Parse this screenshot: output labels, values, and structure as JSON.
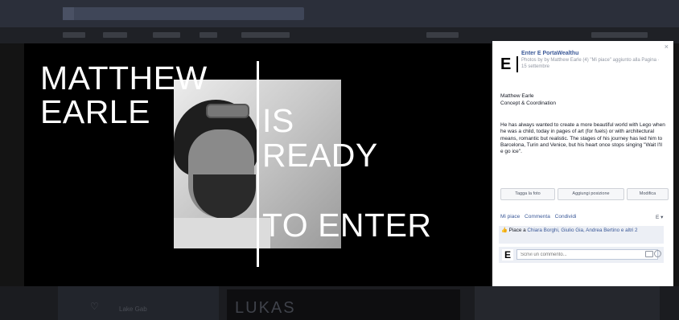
{
  "stage": {
    "headline_name_1": "MATTHEW",
    "headline_name_2": "EARLE",
    "headline_is": "IS",
    "headline_ready": "READY",
    "headline_enter": "TO ENTER"
  },
  "panel": {
    "close_label": "×",
    "logo_letter": "E",
    "page_name": "Enter E PortaWealthu",
    "photo_meta": "Photos by by Matthew Earle (4) \"Mi piace\" aggiunto alla Pagina · 15 settembre",
    "author": "Matthew Earle",
    "role": "Concept & Coordination",
    "description": "He has always wanted to create a more beautiful world with Lego when he was a child, today in pages of art (for fuels) or with architectural means, romantic but realistic. The stages of his journey has led him to Barcelona, Turin and Venice, but his heart once stops singing \"Wait I'll e go ice\".",
    "actions": {
      "tag": "Tagga la foto",
      "place": "Aggiungi posizione",
      "edit": "Modifica"
    },
    "feedback": [
      "Mi piace",
      "Commenta",
      "Condividi"
    ],
    "actor_menu": "E ▾",
    "likes_prefix": "Piace a ",
    "likes_people": "Chiara Borghi, Giulio Gia, Andrea Bertino e altri 2",
    "comment_avatar": "E",
    "comment_placeholder": "Scrivi un commento..."
  },
  "background": {
    "ghost_text": "LUKAS",
    "ghost_small": "Lake Gab",
    "heart": "♡"
  }
}
